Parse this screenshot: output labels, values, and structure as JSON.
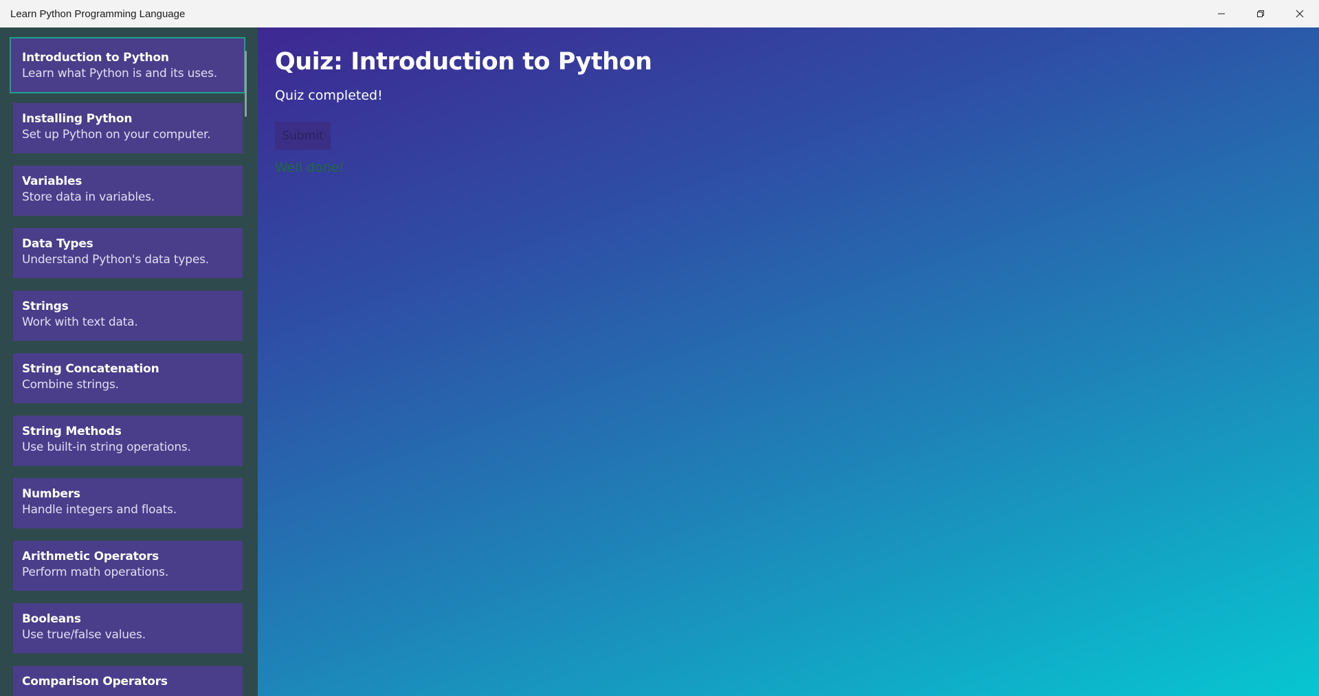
{
  "window": {
    "title": "Learn Python Programming Language"
  },
  "sidebar": {
    "items": [
      {
        "title": "Introduction to Python",
        "description": "Learn what Python is and its uses."
      },
      {
        "title": "Installing Python",
        "description": "Set up Python on your computer."
      },
      {
        "title": "Variables",
        "description": "Store data in variables."
      },
      {
        "title": "Data Types",
        "description": "Understand Python's data types."
      },
      {
        "title": "Strings",
        "description": "Work with text data."
      },
      {
        "title": "String Concatenation",
        "description": "Combine strings."
      },
      {
        "title": "String Methods",
        "description": "Use built-in string operations."
      },
      {
        "title": "Numbers",
        "description": "Handle integers and floats."
      },
      {
        "title": "Arithmetic Operators",
        "description": "Perform math operations."
      },
      {
        "title": "Booleans",
        "description": "Use true/false values."
      },
      {
        "title": "Comparison Operators",
        "description": ""
      }
    ],
    "selected_index": 0
  },
  "main": {
    "title": "Quiz: Introduction to Python",
    "status": "Quiz completed!",
    "submit_label": "Submit",
    "feedback": "Well done!"
  },
  "colors": {
    "sidebar_bg": "#2f4a4c",
    "item_bg": "#4a3d8a",
    "selected_border": "#1fa088",
    "gradient_start": "#3e2891",
    "gradient_end": "#07c6d1",
    "feedback": "#1f6b3a"
  },
  "icons": {
    "minimize": "minimize-icon",
    "maximize": "restore-icon",
    "close": "close-icon"
  }
}
